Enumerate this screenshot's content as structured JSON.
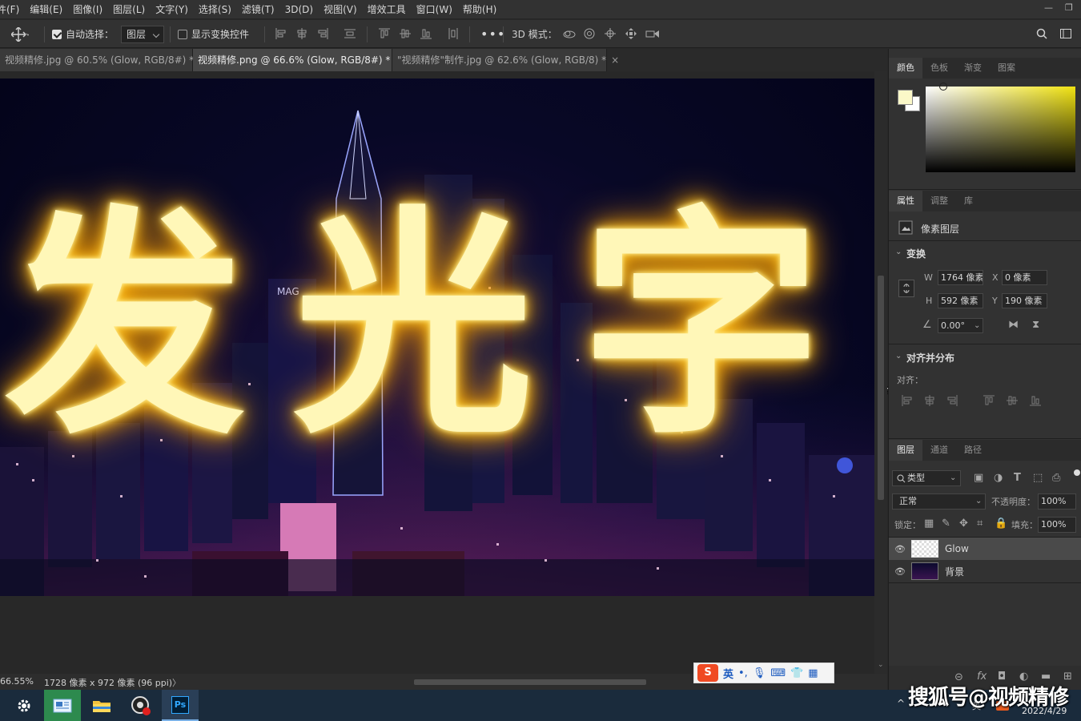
{
  "menu": [
    "件(F)",
    "编辑(E)",
    "图像(I)",
    "图层(L)",
    "文字(Y)",
    "选择(S)",
    "滤镜(T)",
    "3D(D)",
    "视图(V)",
    "增效工具",
    "窗口(W)",
    "帮助(H)"
  ],
  "options": {
    "auto_select_label": "自动选择：",
    "auto_select_value": "图层",
    "show_transform_label": "显示变换控件",
    "mode_3d_label": "3D 模式："
  },
  "tabs": [
    {
      "label": "视频精修.jpg @ 60.5% (Glow, RGB/8#) *",
      "close": "×"
    },
    {
      "label": "视频精修.png @ 66.6% (Glow, RGB/8#) *",
      "close": "×"
    },
    {
      "label": "\"视频精修\"制作.jpg @ 62.6% (Glow, RGB/8) *",
      "close": "×"
    }
  ],
  "canvas": {
    "glow_text": "发光字",
    "building_sign": "MAG",
    "glow_color": "#fff6a6"
  },
  "status": {
    "zoom": "66.55%",
    "doc_info": "1728 像素 x 972 像素 (96 ppi)",
    "arrow": "〉"
  },
  "color_panel": {
    "tabs": [
      "颜色",
      "色板",
      "渐变",
      "图案"
    ]
  },
  "properties_panel": {
    "tabs": [
      "属性",
      "调整",
      "库"
    ],
    "layer_type": "像素图层",
    "transform_title": "变换",
    "w_label": "W",
    "w_value": "1764 像素",
    "x_label": "X",
    "x_value": "0 像素",
    "h_label": "H",
    "h_value": "592 像素",
    "y_label": "Y",
    "y_value": "190 像素",
    "angle_value": "0.00°",
    "align_title": "对齐并分布",
    "align_label": "对齐："
  },
  "layers_panel": {
    "tabs": [
      "图层",
      "通道",
      "路径"
    ],
    "filter_kind": "类型",
    "blend_mode": "正常",
    "opacity_label": "不透明度：",
    "opacity_value": "100%",
    "lock_label": "锁定：",
    "fill_label": "填充：",
    "fill_value": "100%",
    "layers": [
      {
        "name": "Glow",
        "eye": "👁"
      },
      {
        "name": "背景",
        "eye": "👁"
      }
    ]
  },
  "ime": {
    "logo": "S",
    "lang": "英",
    "punct": "•,"
  },
  "watermark": "搜狐号@视频精修",
  "clock": {
    "date": "2022/4/29",
    "lang_indicator": "英"
  },
  "taskbar": {
    "ps_label": "Ps"
  }
}
